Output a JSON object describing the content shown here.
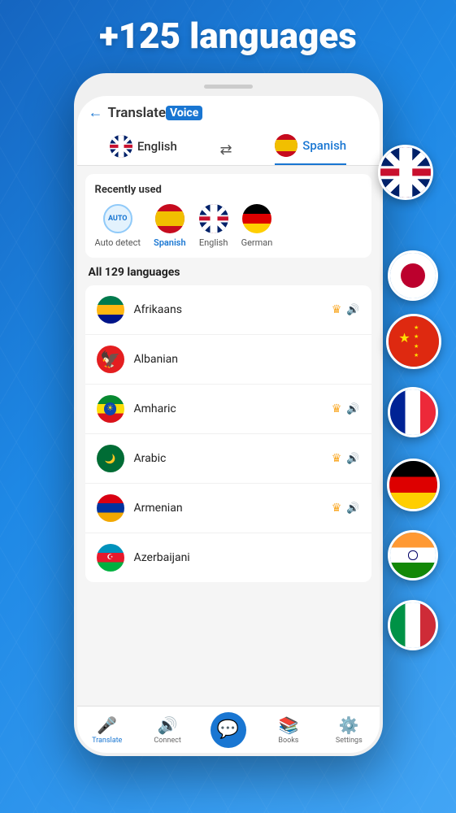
{
  "hero": {
    "title": "+125 languages"
  },
  "header": {
    "back_label": "←",
    "logo_translate": "Translate",
    "logo_voice": "Voice"
  },
  "lang_selector": {
    "source_lang": "English",
    "target_lang": "Spanish"
  },
  "recently_used": {
    "title": "Recently used",
    "items": [
      {
        "label": "Auto detect",
        "type": "auto"
      },
      {
        "label": "Spanish",
        "type": "spain",
        "highlight": true
      },
      {
        "label": "English",
        "type": "uk"
      },
      {
        "label": "German",
        "type": "germany"
      }
    ]
  },
  "all_languages": {
    "title": "All 129 languages",
    "items": [
      {
        "name": "Afrikaans",
        "flag": "sa",
        "crown": true,
        "speaker": true
      },
      {
        "name": "Albanian",
        "flag": "al",
        "crown": false,
        "speaker": false
      },
      {
        "name": "Amharic",
        "flag": "et",
        "crown": true,
        "speaker": true
      },
      {
        "name": "Arabic",
        "flag": "ar",
        "crown": true,
        "speaker": true
      },
      {
        "name": "Armenian",
        "flag": "am",
        "crown": true,
        "speaker": true
      },
      {
        "name": "Azerbaijani",
        "flag": "az",
        "crown": false,
        "speaker": false
      }
    ]
  },
  "bottom_nav": {
    "items": [
      {
        "label": "Translate",
        "active": true
      },
      {
        "label": "Connect",
        "active": false
      },
      {
        "label": "",
        "active": false,
        "center": true
      },
      {
        "label": "Books",
        "active": false
      },
      {
        "label": "Settings",
        "active": false
      }
    ]
  }
}
